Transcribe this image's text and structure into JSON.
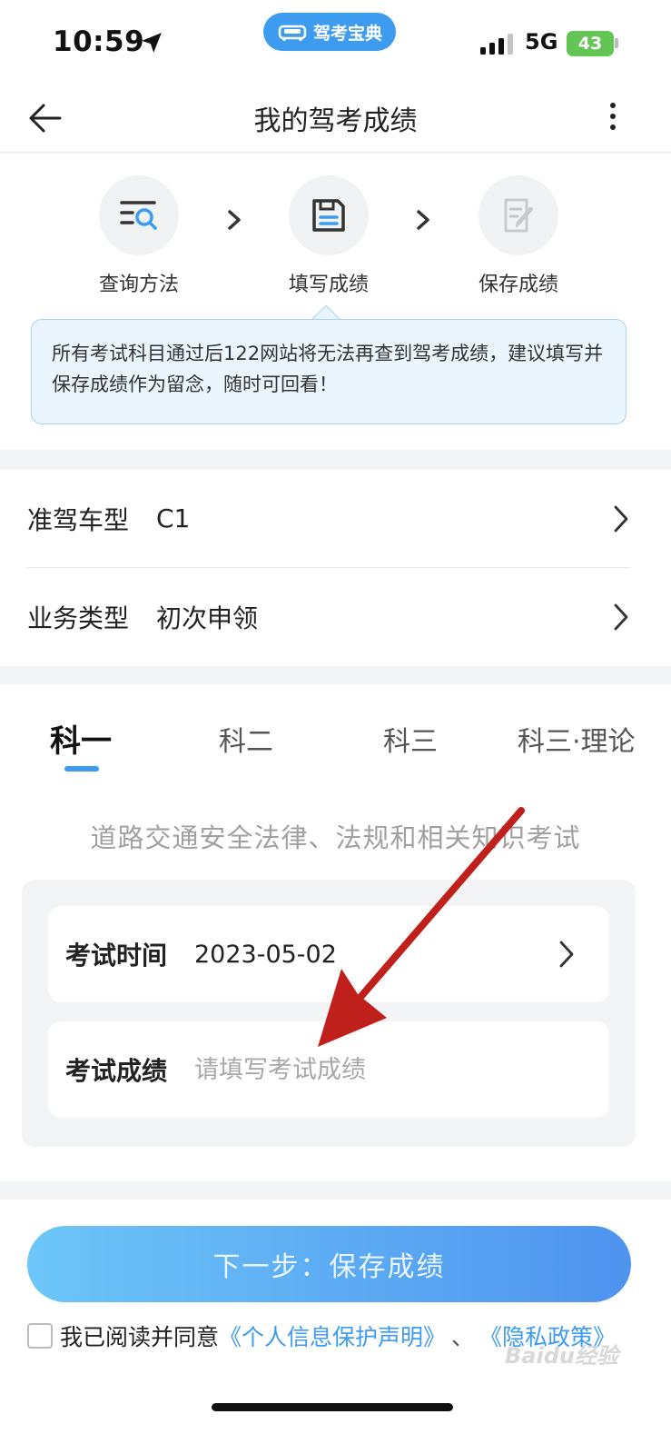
{
  "status_bar": {
    "time": "10:59",
    "app_name": "驾考宝典",
    "network": "5G",
    "battery": "43"
  },
  "nav": {
    "title": "我的驾考成绩"
  },
  "steps": [
    {
      "label": "查询方法",
      "icon": "search-list-icon"
    },
    {
      "label": "填写成绩",
      "icon": "save-form-icon"
    },
    {
      "label": "保存成绩",
      "icon": "edit-doc-icon"
    }
  ],
  "tip": {
    "text": "所有考试科目通过后122网站将无法再查到驾考成绩，建议填写并保存成绩作为留念，随时可回看！"
  },
  "info": {
    "vehicle_label": "准驾车型",
    "vehicle_value": "C1",
    "business_label": "业务类型",
    "business_value": "初次申领"
  },
  "tabs": [
    {
      "label": "科一",
      "active": true
    },
    {
      "label": "科二",
      "active": false
    },
    {
      "label": "科三",
      "active": false
    },
    {
      "label": "科三·理论",
      "active": false
    }
  ],
  "subject": {
    "description": "道路交通安全法律、法规和相关知识考试"
  },
  "form": {
    "date_label": "考试时间",
    "date_value": "2023-05-02",
    "score_label": "考试成绩",
    "score_placeholder": "请填写考试成绩"
  },
  "footer": {
    "next_button": "下一步：保存成绩",
    "agree_prefix": "我已阅读并同意",
    "privacy_statement_link": "《个人信息保护声明》",
    "separator": "、",
    "privacy_policy_link": "《隐私政策》",
    "watermark": "Baidu经验"
  },
  "colors": {
    "accent": "#3d9bf0",
    "annotation_arrow": "#c0201c",
    "battery": "#62c554"
  }
}
